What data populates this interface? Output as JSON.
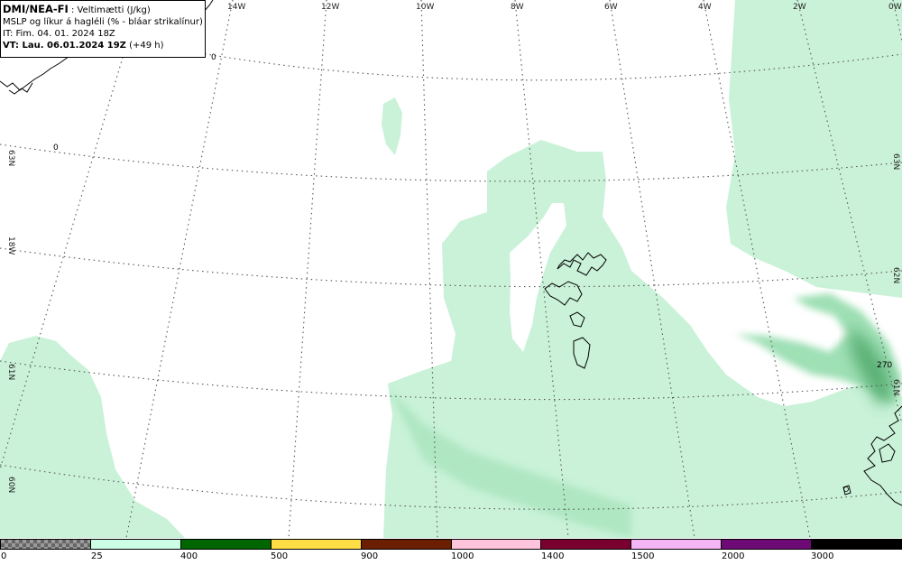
{
  "header": {
    "model": "DMI/NEA-FI",
    "variable": " : Veltimætti (J/kg)",
    "line2": "MSLP og líkur á hagléli (% - bláar strikalínur)",
    "line3": "IT: Fim. 04. 01. 2024 18Z",
    "vt_label": "VT: Lau. 06.01.2024 19Z",
    "vt_offset": " (+49 h)"
  },
  "map": {
    "lon_labels": [
      "14W",
      "12W",
      "10W",
      "8W",
      "6W",
      "4W",
      "2W",
      "0W"
    ],
    "lat_labels_left": [
      "63N",
      "18W",
      "61N",
      "60N"
    ],
    "lat_labels_right": [
      "63N",
      "62N",
      "61N"
    ],
    "contour_labels": [
      "0",
      "0",
      "270"
    ],
    "colors": {
      "background": "#ffffff",
      "cape_light": "#c9f2d8",
      "cape_medium": "#9fe0b5",
      "cape_dark": "#4fa86a",
      "coastline": "#000000",
      "grid": "#555555"
    }
  },
  "legend": {
    "labels": [
      "0",
      "25",
      "400",
      "500",
      "900",
      "1000",
      "1400",
      "1500",
      "2000",
      "3000"
    ],
    "colors": [
      "checker",
      "#ccffe6",
      "#006600",
      "#ffdd44",
      "#6b1e00",
      "#ffc4dc",
      "#7a0030",
      "#f4b6f4",
      "#6e0a76",
      "#000000"
    ]
  }
}
